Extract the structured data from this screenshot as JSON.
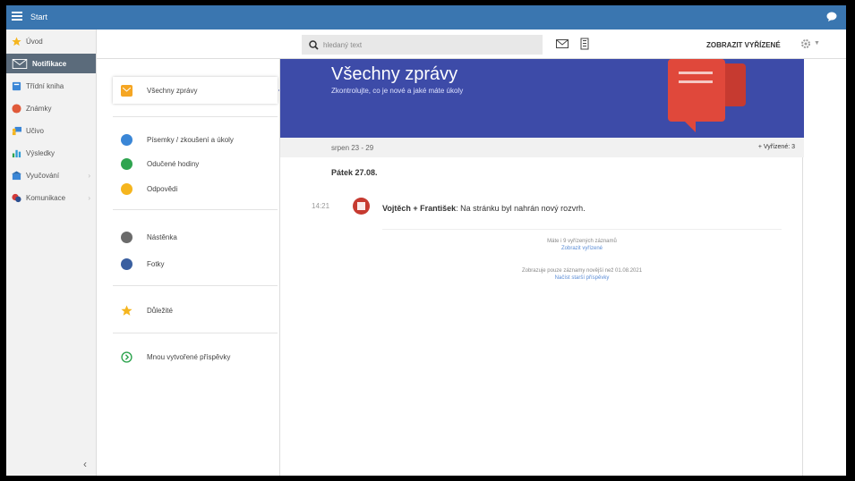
{
  "topbar": {
    "title": "Start"
  },
  "leftnav": {
    "items": [
      {
        "label": "Úvod",
        "icon": "star-icon",
        "color": "#f5b51e"
      },
      {
        "label": "Notifikace",
        "icon": "envelope-icon",
        "color": "#ffffff"
      },
      {
        "label": "Třídní kniha",
        "icon": "book-icon",
        "color": "#3a86d6"
      },
      {
        "label": "Známky",
        "icon": "grade-icon",
        "color": "#e05a3a"
      },
      {
        "label": "Učivo",
        "icon": "teacher-icon",
        "color": "#3a86d6"
      },
      {
        "label": "Výsledky",
        "icon": "bar-chart-icon",
        "color": "#2e9cd6"
      },
      {
        "label": "Vyučování",
        "icon": "school-icon",
        "color": "#3a86d6"
      },
      {
        "label": "Komunikace",
        "icon": "chat-bubbles-icon",
        "color": "#d23a3a"
      }
    ]
  },
  "header": {
    "search_placeholder": "hledaný text",
    "show_done": "ZOBRAZIT VYŘÍZENÉ"
  },
  "midcol": {
    "items": [
      {
        "label": "Všechny zprávy",
        "color": "#f5a623"
      },
      {
        "label": "Písemky / zkoušení a úkoly",
        "color": "#3a86d6"
      },
      {
        "label": "Odučené hodiny",
        "color": "#2ea44f"
      },
      {
        "label": "Odpovědi",
        "color": "#f5b51e"
      },
      {
        "label": "Nástěnka",
        "color": "#6b6b6b"
      },
      {
        "label": "Fotky",
        "color": "#3a5fa0"
      },
      {
        "label": "Důležité",
        "color": "#f5b51e"
      },
      {
        "label": "Mnou vytvořené příspěvky",
        "color": "#2ea44f"
      }
    ]
  },
  "main": {
    "title": "Všechny zprávy",
    "subtitle": "Zkontrolujte, co je nové a jaké máte úkoly",
    "week": "srpen 23 - 29",
    "done_count": "+ Vyřízené: 3",
    "day": "Pátek 27.08.",
    "message": {
      "time": "14:21",
      "author": "Vojtěch + František",
      "text": ": Na stránku byl nahrán nový rozvrh."
    },
    "info1": "Máte i 9 vyřízených záznamů",
    "info1_link": "Zobrazit vyřízené",
    "info2": "Zobrazuje pouze záznamy novější než 01.08.2021",
    "info2_link": "Načíst starší příspěvky"
  }
}
